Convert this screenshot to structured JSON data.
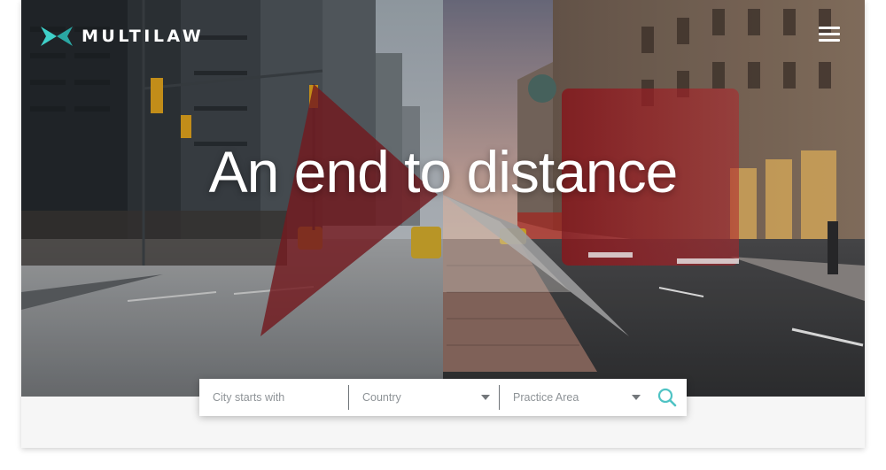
{
  "brand": {
    "name": "MULTILAW",
    "logo_icon": "multilaw-bowtie-logo-icon",
    "accent_color": "#3fd0c9"
  },
  "header": {
    "menu_icon": "hamburger-menu-icon"
  },
  "hero": {
    "headline": "An end to distance"
  },
  "search": {
    "city_placeholder": "City starts with",
    "country_placeholder": "Country",
    "practice_placeholder": "Practice Area",
    "search_icon": "search-icon",
    "icon_color": "#4fc3c4"
  }
}
